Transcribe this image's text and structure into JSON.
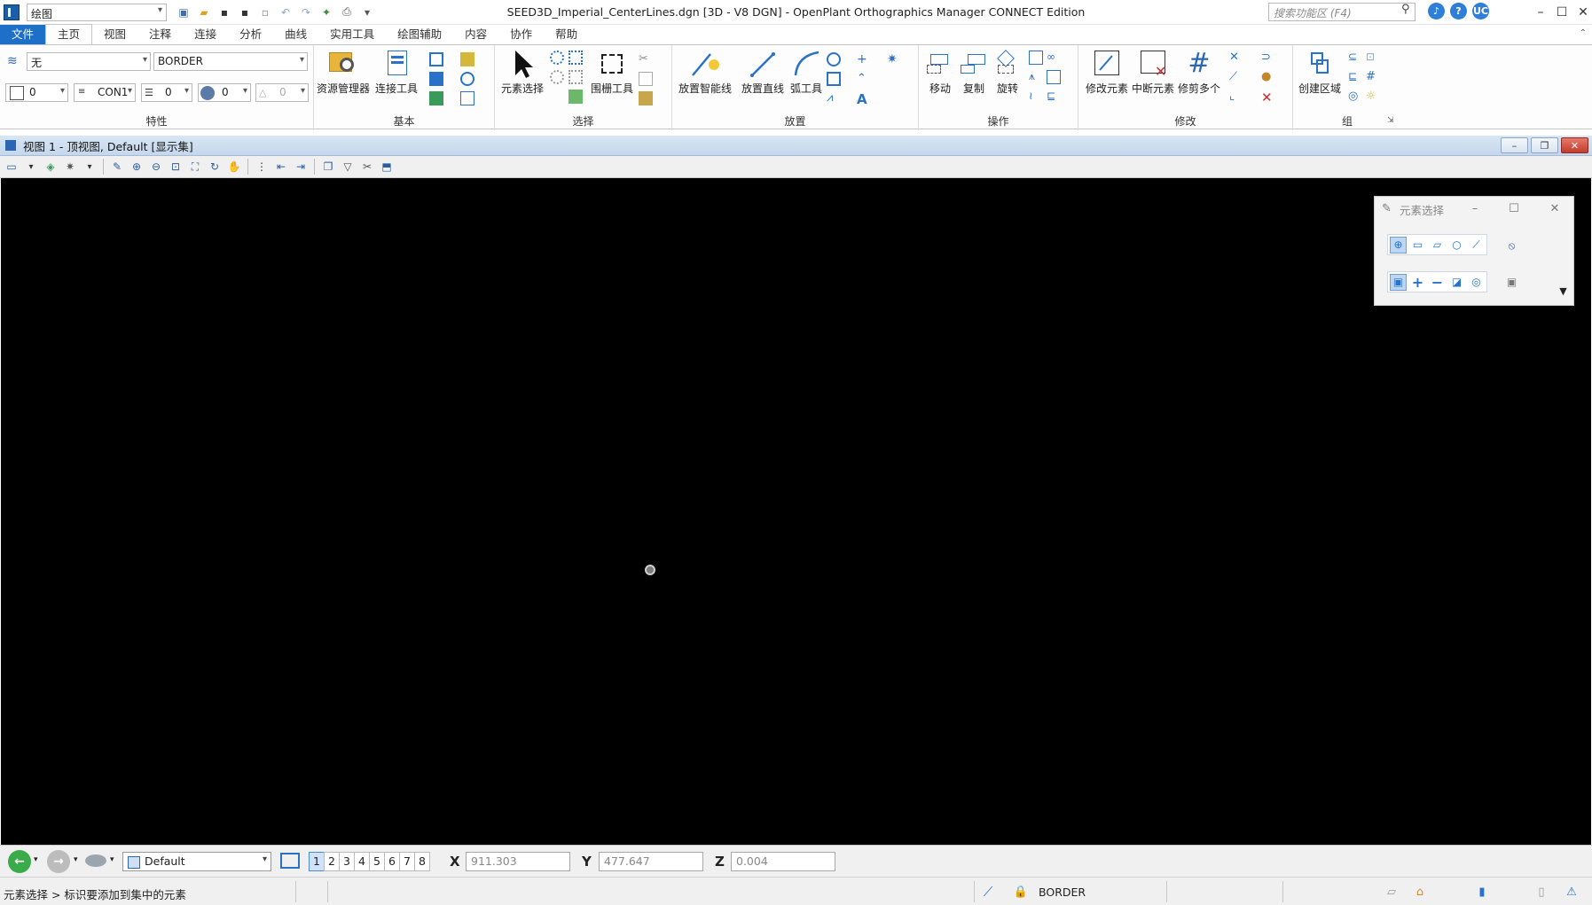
{
  "titlebar": {
    "workflow": "绘图",
    "document_title": "SEED3D_Imperial_CenterLines.dgn [3D - V8 DGN] - OpenPlant Orthographics Manager CONNECT Edition",
    "search_placeholder": "搜索功能区 (F4)",
    "user_badge": "UC"
  },
  "tabs": [
    "文件",
    "主页",
    "视图",
    "注释",
    "连接",
    "分析",
    "曲线",
    "实用工具",
    "绘图辅助",
    "内容",
    "协作",
    "帮助"
  ],
  "active_tab": "主页",
  "ribbon": {
    "attributes": {
      "level_combo": "无",
      "style_combo": "BORDER",
      "color_combo": "0",
      "linestyle_combo": "CON1",
      "weight_combo": "0",
      "transparency_combo": "0",
      "priority_combo": "0",
      "label": "特性"
    },
    "primary": {
      "explorer": "资源管理器",
      "attach_tools": "连接工具",
      "label": "基本"
    },
    "selection": {
      "element_selection": "元素选择",
      "fence_tools": "围栅工具",
      "label": "选择"
    },
    "placement": {
      "smartline": "放置智能线",
      "line": "放置直线",
      "arc_tools": "弧工具",
      "label": "放置"
    },
    "manipulate": {
      "move": "移动",
      "copy": "复制",
      "rotate": "旋转",
      "label": "操作"
    },
    "modify": {
      "modify_element": "修改元素",
      "break_element": "中断元素",
      "trim_multiple": "修剪多个",
      "label": "修改"
    },
    "groups": {
      "create_region": "创建区域",
      "label": "组"
    }
  },
  "view": {
    "title": "视图 1 - 顶视图, Default [显示集]"
  },
  "palette": {
    "title": "元素选择"
  },
  "bottom": {
    "view_group": "Default",
    "view_numbers": [
      "1",
      "2",
      "3",
      "4",
      "5",
      "6",
      "7",
      "8"
    ],
    "active_view": "1",
    "x_label": "X",
    "x_value": "911.303",
    "y_label": "Y",
    "y_value": "477.647",
    "z_label": "Z",
    "z_value": "0.004"
  },
  "status": {
    "prompt": "元素选择 > 标识要添加到集中的元素",
    "active_level": "BORDER"
  },
  "colors": {
    "accent": "#1d6fc7",
    "canvas": "#000000"
  }
}
